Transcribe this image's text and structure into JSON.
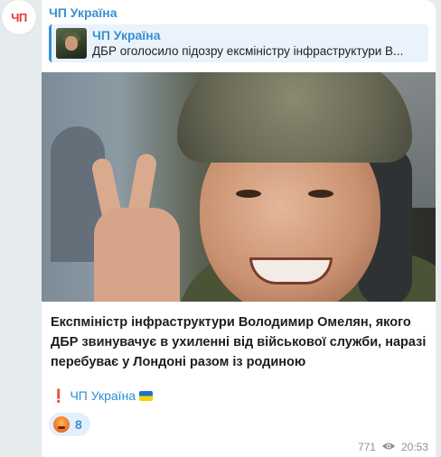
{
  "channel": {
    "name": "ЧП Україна",
    "avatar_text": "ЧП"
  },
  "reply": {
    "title": "ЧП Україна",
    "text": "ДБР оголосило підозру ексміністру інфраструктури В..."
  },
  "post": {
    "caption": "Експміністр інфраструктури Володимир Омелян, якого ДБР звинувачує в ухиленні від військової служби, наразі перебуває у Лондоні разом із родиною",
    "signature": "ЧП Україна",
    "signature_mark": "❗"
  },
  "reaction": {
    "icon": "angry-face-icon",
    "count": "8"
  },
  "footer": {
    "views": "771",
    "time": "20:53"
  },
  "colors": {
    "accent": "#3a8fd1",
    "logo": "#e53935",
    "background": "#e6ebee"
  }
}
